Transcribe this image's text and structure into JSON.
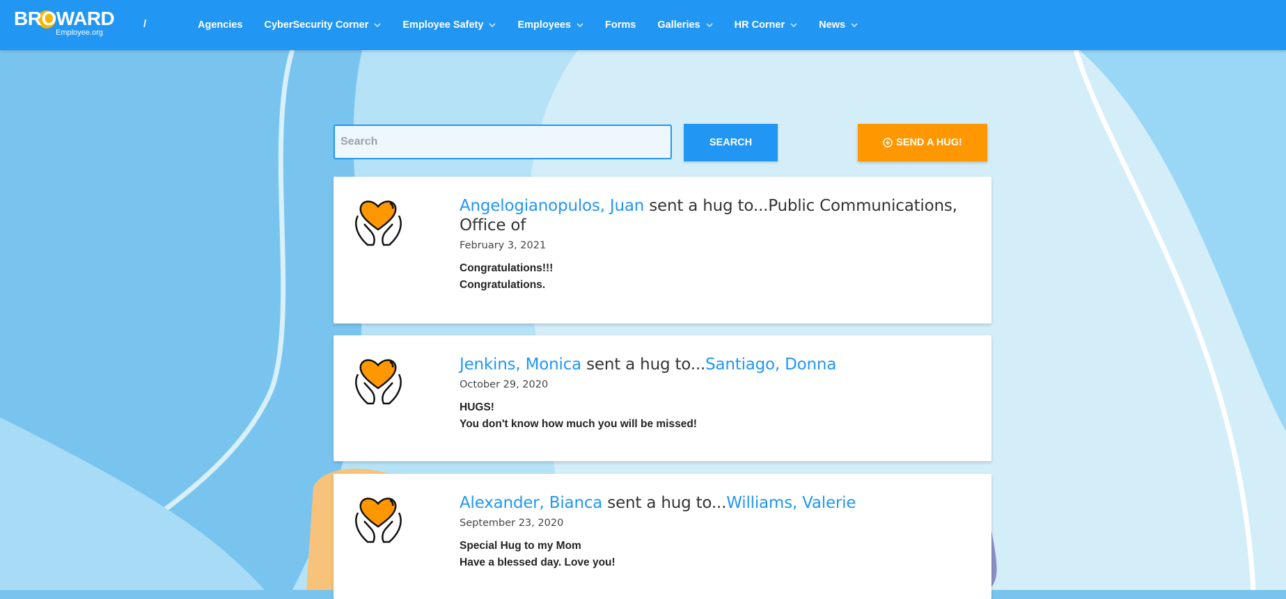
{
  "header": {
    "logo_main": "BROWARD",
    "logo_sub": "Employee.org",
    "slash": "/",
    "nav": [
      {
        "label": "Agencies",
        "dropdown": false
      },
      {
        "label": "CyberSecurity Corner",
        "dropdown": true
      },
      {
        "label": "Employee Safety",
        "dropdown": true
      },
      {
        "label": "Employees",
        "dropdown": true
      },
      {
        "label": "Forms",
        "dropdown": false
      },
      {
        "label": "Galleries",
        "dropdown": true
      },
      {
        "label": "HR Corner",
        "dropdown": true
      },
      {
        "label": "News",
        "dropdown": true
      }
    ]
  },
  "search": {
    "placeholder": "Search",
    "value": "",
    "button_label": "SEARCH",
    "send_hug_label": "SEND A HUG!"
  },
  "hugs": [
    {
      "sender": "Angelogianopulos, Juan",
      "verb": " sent a hug to...",
      "recipient": "Public Communications, Office of",
      "recipient_is_link": false,
      "date": "February 3, 2021",
      "subject": "Congratulations!!!",
      "message": "Congratulations."
    },
    {
      "sender": "Jenkins, Monica",
      "verb": " sent a hug to...",
      "recipient": "Santiago, Donna",
      "recipient_is_link": true,
      "date": "October 29, 2020",
      "subject": "HUGS!",
      "message": "You don't know how much you will be missed!"
    },
    {
      "sender": "Alexander, Bianca",
      "verb": " sent a hug to...",
      "recipient": "Williams, Valerie",
      "recipient_is_link": true,
      "date": "September 23, 2020",
      "subject": "Special Hug to my Mom",
      "message": "Have a blessed day. Love you!"
    }
  ],
  "colors": {
    "header": "#2196f3",
    "link": "#2196f3",
    "send_hug": "#ff9800",
    "background": "#79c4ef"
  }
}
